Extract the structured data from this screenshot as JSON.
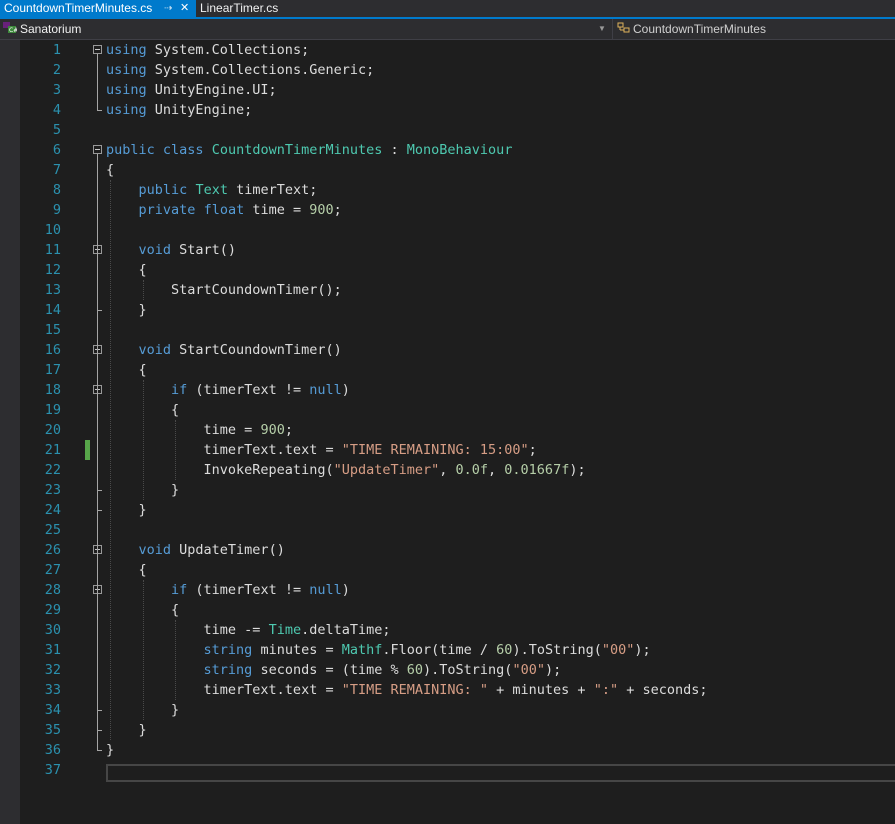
{
  "tabs": [
    {
      "label": "CountdownTimerMinutes.cs",
      "pin_icon": "pin-icon",
      "close_icon": "close-icon",
      "active": true
    },
    {
      "label": "LinearTimer.cs",
      "active": false
    }
  ],
  "navbar": {
    "project": "Sanatorium",
    "project_icon": "csharp-project-icon",
    "class_selector": "CountdownTimerMinutes",
    "class_icon": "class-icon"
  },
  "colors": {
    "keyword": "#569cd6",
    "type": "#4ec9b0",
    "string": "#d69d85",
    "number": "#b5cea8",
    "text": "#dcdcdc",
    "line_number": "#2b91af",
    "accent": "#007acc",
    "change_marker": "#57a64a"
  },
  "editor": {
    "line_numbers": [
      "1",
      "2",
      "3",
      "4",
      "5",
      "6",
      "7",
      "8",
      "9",
      "10",
      "11",
      "12",
      "13",
      "14",
      "15",
      "16",
      "17",
      "18",
      "19",
      "20",
      "21",
      "22",
      "23",
      "24",
      "25",
      "26",
      "27",
      "28",
      "29",
      "30",
      "31",
      "32",
      "33",
      "34",
      "35",
      "36",
      "37"
    ],
    "lines": [
      [
        [
          "kw",
          "using"
        ],
        [
          "t",
          " System.Collections;"
        ]
      ],
      [
        [
          "kw",
          "using"
        ],
        [
          "t",
          " System.Collections.Generic;"
        ]
      ],
      [
        [
          "kw",
          "using"
        ],
        [
          "t",
          " UnityEngine.UI;"
        ]
      ],
      [
        [
          "kw",
          "using"
        ],
        [
          "t",
          " UnityEngine;"
        ]
      ],
      [],
      [
        [
          "kw",
          "public"
        ],
        [
          "t",
          " "
        ],
        [
          "kw",
          "class"
        ],
        [
          "t",
          " "
        ],
        [
          "ty",
          "CountdownTimerMinutes"
        ],
        [
          "t",
          " : "
        ],
        [
          "ty",
          "MonoBehaviour"
        ]
      ],
      [
        [
          "t",
          "{"
        ]
      ],
      [
        [
          "t",
          "    "
        ],
        [
          "kw",
          "public"
        ],
        [
          "t",
          " "
        ],
        [
          "ty",
          "Text"
        ],
        [
          "t",
          " timerText;"
        ]
      ],
      [
        [
          "t",
          "    "
        ],
        [
          "kw",
          "private"
        ],
        [
          "t",
          " "
        ],
        [
          "kw",
          "float"
        ],
        [
          "t",
          " time = "
        ],
        [
          "num",
          "900"
        ],
        [
          "t",
          ";"
        ]
      ],
      [],
      [
        [
          "t",
          "    "
        ],
        [
          "kw",
          "void"
        ],
        [
          "t",
          " Start()"
        ]
      ],
      [
        [
          "t",
          "    {"
        ]
      ],
      [
        [
          "t",
          "        StartCoundownTimer();"
        ]
      ],
      [
        [
          "t",
          "    }"
        ]
      ],
      [],
      [
        [
          "t",
          "    "
        ],
        [
          "kw",
          "void"
        ],
        [
          "t",
          " StartCoundownTimer()"
        ]
      ],
      [
        [
          "t",
          "    {"
        ]
      ],
      [
        [
          "t",
          "        "
        ],
        [
          "kw",
          "if"
        ],
        [
          "t",
          " (timerText != "
        ],
        [
          "kw",
          "null"
        ],
        [
          "t",
          ")"
        ]
      ],
      [
        [
          "t",
          "        {"
        ]
      ],
      [
        [
          "t",
          "            time = "
        ],
        [
          "num",
          "900"
        ],
        [
          "t",
          ";"
        ]
      ],
      [
        [
          "t",
          "            timerText.text = "
        ],
        [
          "str",
          "\"TIME REMAINING: 15:00\""
        ],
        [
          "t",
          ";"
        ]
      ],
      [
        [
          "t",
          "            InvokeRepeating("
        ],
        [
          "str",
          "\"UpdateTimer\""
        ],
        [
          "t",
          ", "
        ],
        [
          "num",
          "0.0f"
        ],
        [
          "t",
          ", "
        ],
        [
          "num",
          "0.01667f"
        ],
        [
          "t",
          ");"
        ]
      ],
      [
        [
          "t",
          "        }"
        ]
      ],
      [
        [
          "t",
          "    }"
        ]
      ],
      [],
      [
        [
          "t",
          "    "
        ],
        [
          "kw",
          "void"
        ],
        [
          "t",
          " UpdateTimer()"
        ]
      ],
      [
        [
          "t",
          "    {"
        ]
      ],
      [
        [
          "t",
          "        "
        ],
        [
          "kw",
          "if"
        ],
        [
          "t",
          " (timerText != "
        ],
        [
          "kw",
          "null"
        ],
        [
          "t",
          ")"
        ]
      ],
      [
        [
          "t",
          "        {"
        ]
      ],
      [
        [
          "t",
          "            time -= "
        ],
        [
          "ty",
          "Time"
        ],
        [
          "t",
          ".deltaTime;"
        ]
      ],
      [
        [
          "t",
          "            "
        ],
        [
          "kw",
          "string"
        ],
        [
          "t",
          " minutes = "
        ],
        [
          "ty",
          "Mathf"
        ],
        [
          "t",
          ".Floor(time / "
        ],
        [
          "num",
          "60"
        ],
        [
          "t",
          ").ToString("
        ],
        [
          "str",
          "\"00\""
        ],
        [
          "t",
          ");"
        ]
      ],
      [
        [
          "t",
          "            "
        ],
        [
          "kw",
          "string"
        ],
        [
          "t",
          " seconds = (time % "
        ],
        [
          "num",
          "60"
        ],
        [
          "t",
          ").ToString("
        ],
        [
          "str",
          "\"00\""
        ],
        [
          "t",
          ");"
        ]
      ],
      [
        [
          "t",
          "            timerText.text = "
        ],
        [
          "str",
          "\"TIME REMAINING: \""
        ],
        [
          "t",
          " + minutes + "
        ],
        [
          "str",
          "\":\""
        ],
        [
          "t",
          " + seconds;"
        ]
      ],
      [
        [
          "t",
          "        }"
        ]
      ],
      [
        [
          "t",
          "    }"
        ]
      ],
      [
        [
          "t",
          "}"
        ]
      ],
      []
    ]
  }
}
